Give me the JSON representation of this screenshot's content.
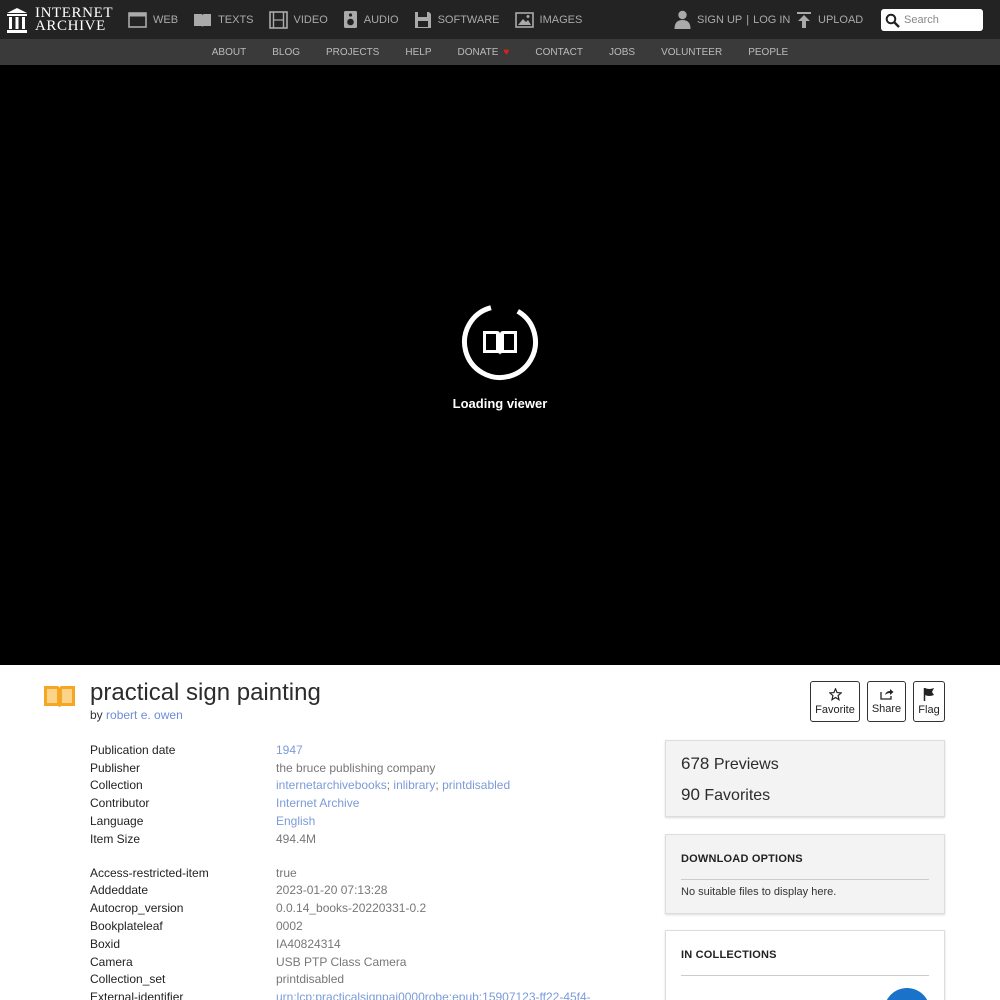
{
  "nav": {
    "logo_line1": "INTERNET",
    "logo_line2": "ARCHIVE",
    "media": [
      {
        "label": "WEB",
        "icon": "web-icon"
      },
      {
        "label": "TEXTS",
        "icon": "book-icon"
      },
      {
        "label": "VIDEO",
        "icon": "film-icon"
      },
      {
        "label": "AUDIO",
        "icon": "speaker-icon"
      },
      {
        "label": "SOFTWARE",
        "icon": "floppy-icon"
      },
      {
        "label": "IMAGES",
        "icon": "image-icon"
      }
    ],
    "signup": "SIGN UP",
    "separator": "|",
    "login": "LOG IN",
    "upload": "UPLOAD",
    "search_placeholder": "Search"
  },
  "subnav": {
    "items": [
      "ABOUT",
      "BLOG",
      "PROJECTS",
      "HELP",
      "DONATE",
      "CONTACT",
      "JOBS",
      "VOLUNTEER",
      "PEOPLE"
    ]
  },
  "viewer": {
    "loading_text": "Loading viewer"
  },
  "item": {
    "title": "practical sign painting",
    "by_label": "by",
    "author": "robert e. owen",
    "actions": {
      "favorite": "Favorite",
      "share": "Share",
      "flag": "Flag"
    }
  },
  "metadata": {
    "primary": [
      {
        "key": "Publication date",
        "values": [
          "1947"
        ],
        "link": true
      },
      {
        "key": "Publisher",
        "values": [
          "the bruce publishing company"
        ],
        "link": false
      },
      {
        "key": "Collection",
        "values": [
          "internetarchivebooks",
          "inlibrary",
          "printdisabled"
        ],
        "link": true
      },
      {
        "key": "Contributor",
        "values": [
          "Internet Archive"
        ],
        "link": true
      },
      {
        "key": "Language",
        "values": [
          "English"
        ],
        "link": true
      },
      {
        "key": "Item Size",
        "values": [
          "494.4M"
        ],
        "link": false
      }
    ],
    "secondary": [
      {
        "key": "Access-restricted-item",
        "values": [
          "true"
        ],
        "link": false
      },
      {
        "key": "Addeddate",
        "values": [
          "2023-01-20 07:13:28"
        ],
        "link": false
      },
      {
        "key": "Autocrop_version",
        "values": [
          "0.0.14_books-20220331-0.2"
        ],
        "link": false
      },
      {
        "key": "Bookplateleaf",
        "values": [
          "0002"
        ],
        "link": false
      },
      {
        "key": "Boxid",
        "values": [
          "IA40824314"
        ],
        "link": false
      },
      {
        "key": "Camera",
        "values": [
          "USB PTP Class Camera"
        ],
        "link": false
      },
      {
        "key": "Collection_set",
        "values": [
          "printdisabled"
        ],
        "link": false
      },
      {
        "key": "External-identifier",
        "values": [
          "urn:lcp:practicalsignpai0000robe:epub:15907123-ff22-45f4-"
        ],
        "link": true
      }
    ]
  },
  "stats": {
    "previews_count": "678",
    "previews_label": "Previews",
    "favorites_count": "90",
    "favorites_label": "Favorites"
  },
  "downloads": {
    "heading": "DOWNLOAD OPTIONS",
    "note": "No suitable files to display here."
  },
  "collections": {
    "heading": "IN COLLECTIONS"
  },
  "colors": {
    "topbar": "#232323",
    "subbar": "#3a3a3a",
    "link": "#7b9bd8",
    "book_icon": "#f5a623",
    "heart": "#e02020"
  }
}
